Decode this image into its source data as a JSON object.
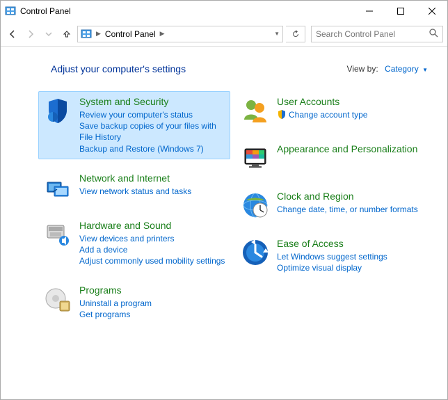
{
  "titlebar": {
    "title": "Control Panel"
  },
  "address": {
    "crumb": "Control Panel"
  },
  "search": {
    "placeholder": "Search Control Panel"
  },
  "header": {
    "title": "Adjust your computer's settings",
    "view_by_label": "View by:",
    "view_by_value": "Category"
  },
  "left": [
    {
      "id": "system-security",
      "title": "System and Security",
      "selected": true,
      "links": [
        "Review your computer's status",
        "Save backup copies of your files with File History",
        "Backup and Restore (Windows 7)"
      ]
    },
    {
      "id": "network-internet",
      "title": "Network and Internet",
      "links": [
        "View network status and tasks"
      ]
    },
    {
      "id": "hardware-sound",
      "title": "Hardware and Sound",
      "links": [
        "View devices and printers",
        "Add a device",
        "Adjust commonly used mobility settings"
      ]
    },
    {
      "id": "programs",
      "title": "Programs",
      "links": [
        "Uninstall a program",
        "Get programs"
      ]
    }
  ],
  "right": [
    {
      "id": "user-accounts",
      "title": "User Accounts",
      "links": [
        "Change account type"
      ],
      "linkIcon": true
    },
    {
      "id": "appearance-personalization",
      "title": "Appearance and Personalization",
      "links": []
    },
    {
      "id": "clock-region",
      "title": "Clock and Region",
      "links": [
        "Change date, time, or number formats"
      ]
    },
    {
      "id": "ease-of-access",
      "title": "Ease of Access",
      "links": [
        "Let Windows suggest settings",
        "Optimize visual display"
      ]
    }
  ]
}
